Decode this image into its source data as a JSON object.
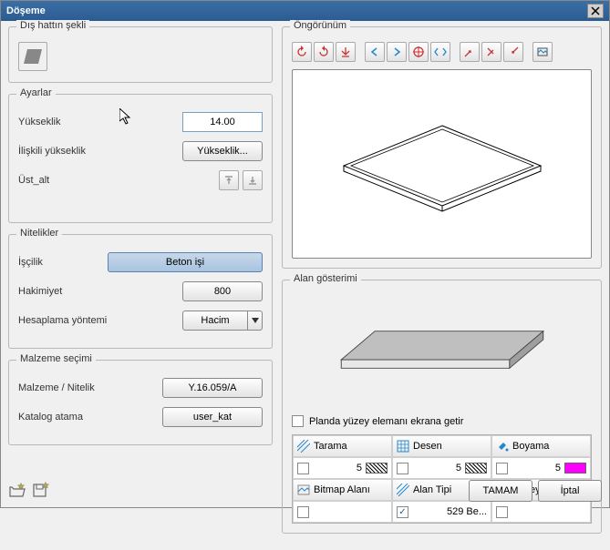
{
  "title": "Döşeme",
  "outline": {
    "title": "Dış hattın şekli"
  },
  "settings": {
    "title": "Ayarlar",
    "height_label": "Yükseklik",
    "height_value": "14.00",
    "relheight_label": "İlişkili yükseklik",
    "relheight_btn": "Yükseklik...",
    "topbottom_label": "Üst_alt"
  },
  "attributes": {
    "title": "Nitelikler",
    "work_label": "İşçilik",
    "work_value": "Beton işi",
    "dominance_label": "Hakimiyet",
    "dominance_value": "800",
    "calc_label": "Hesaplama yöntemi",
    "calc_value": "Hacim"
  },
  "material": {
    "title": "Malzeme seçimi",
    "matattr_label": "Malzeme / Nitelik",
    "matattr_value": "Y.16.059/A",
    "catalog_label": "Katalog atama",
    "catalog_value": "user_kat"
  },
  "preview": {
    "title": "Öngörünüm"
  },
  "area": {
    "title": "Alan gösterimi",
    "plan_cb_label": "Planda yüzey elemanı ekrana getir",
    "headers": [
      "Tarama",
      "Desen",
      "Boyama"
    ],
    "row1": [
      "5",
      "5",
      "5"
    ],
    "headers2": [
      "Bitmap Alanı",
      "Alan Tipi",
      "Yüzey (anim..."
    ],
    "row2_center": "529 Be..."
  },
  "buttons": {
    "ok": "TAMAM",
    "cancel": "İptal"
  }
}
